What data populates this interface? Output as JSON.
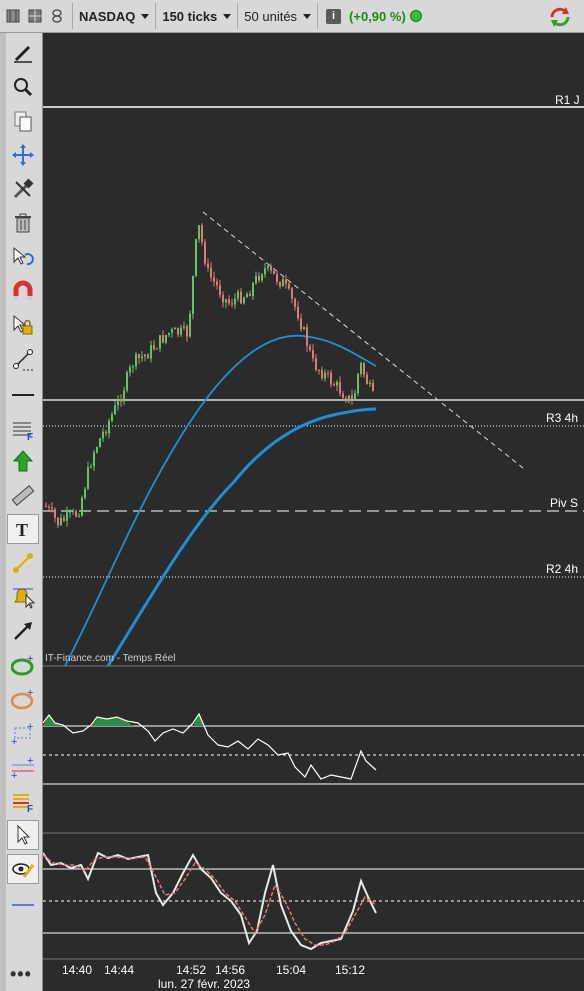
{
  "toolbar": {
    "symbol": "NASDAQ",
    "interval": "150 ticks",
    "units": "50 unités",
    "info_icon": "info-icon",
    "variation": "(+0,90 %)",
    "status_color": "#2fbf2f",
    "refresh_icon": "refresh-icon"
  },
  "left_tools": [
    "pencil-icon",
    "magnifier-icon",
    "copy-icon",
    "move-arrows-icon",
    "tools-icon",
    "trash-icon",
    "undo-cursor-icon",
    "magnet-icon",
    "lock-cursor-icon",
    "segment-icon",
    "horizontal-line-icon",
    "fibonacci-icon",
    "up-arrow-icon",
    "ruler-icon",
    "text-icon",
    "line-tool-icon",
    "bell-alert-icon",
    "arrow-icon",
    "ellipse-icon",
    "ellipse-orange-icon",
    "rectangle-icon",
    "parallel-lines-icon",
    "fibonacci-levels-icon",
    "pointer-icon",
    "eye-pencil-icon",
    "separator-line-icon"
  ],
  "levels": {
    "r1j": "R1 J",
    "r3_4h": "R3 4h",
    "pivs": "Piv S",
    "r2_4h": "R2 4h"
  },
  "watermark": "IT-Finance.com - Temps Réel",
  "x_axis": {
    "ticks": [
      "14:40",
      "14:44",
      "14:52",
      "14:56",
      "15:04",
      "15:12"
    ],
    "date": "lun. 27 févr. 2023"
  },
  "colors": {
    "background": "#2b2b2b",
    "candle_up": "#62c462",
    "candle_down": "#e07a7a",
    "moving_average": "#1e8fd6",
    "oscillator_line": "#ffffff",
    "oscillator_signal": "#e07a7a",
    "oscillator_fill": "#2e8b4a"
  }
}
